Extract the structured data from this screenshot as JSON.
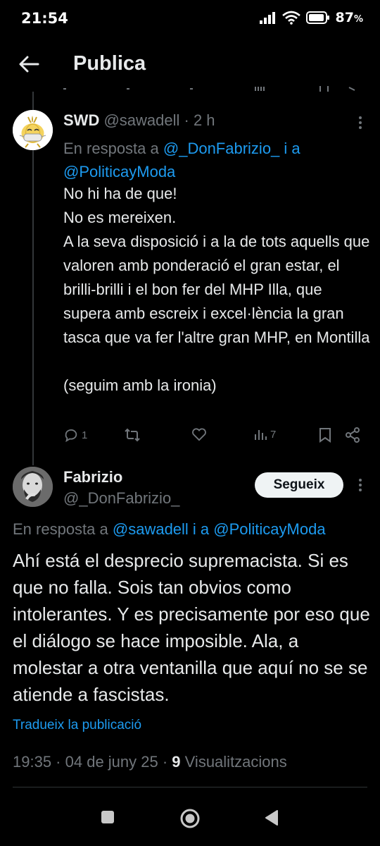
{
  "status_bar": {
    "time": "21:54",
    "battery": "87",
    "battery_unit": "%"
  },
  "header": {
    "title": "Publica"
  },
  "tweet1": {
    "name": "SWD",
    "handle": "@sawadell",
    "sep": " · ",
    "time": "2 h",
    "reply_prefix": "En resposta a ",
    "reply_mention1": "@_DonFabrizio_",
    "reply_mid": " i a",
    "reply_mention2": "@PoliticayModa",
    "body": "No hi ha de que!\nNo es mereixen.\nA la seva disposició i a la de tots aquells que valoren amb ponderació el gran estar, el brilli-brilli i el bon fer del MHP Illa, que supera amb escreix i excel·lència la gran tasca que va fer l'altre gran MHP, en Montilla\n\n(seguim amb la ironia)",
    "reply_count": "1",
    "views_count": "7"
  },
  "tweet2": {
    "name": "Fabrizio",
    "handle": "@_DonFabrizio_",
    "follow_label": "Segueix",
    "reply_prefix": "En resposta a ",
    "reply_mention1": "@sawadell",
    "reply_mid": " i a ",
    "reply_mention2": "@PoliticayModa",
    "body": "Ahí está el desprecio supremacista. Si es que no falla. Sois tan obvios como intolerantes. Y es precisamente por eso que el diálogo se hace imposible. Ala, a molestar a otra ventanilla que aquí no se se atiende a fascistas.",
    "translate": "Tradueix la publicació",
    "time": "19:35",
    "sep": " · ",
    "date": "04 de juny 25",
    "sep2": " · ",
    "views": "9",
    "views_label": " Visualitzacions"
  },
  "colors": {
    "background": "#000000",
    "text": "#e7e9ea",
    "muted": "#71767b",
    "link": "#1d9bf0",
    "follow_bg": "#eff3f4"
  },
  "icons": {
    "back": "arrow-left-icon",
    "more": "more-vertical-icon",
    "reply": "reply-icon",
    "retweet": "retweet-icon",
    "like": "heart-icon",
    "views": "views-icon",
    "bookmark": "bookmark-icon",
    "share": "share-icon"
  }
}
